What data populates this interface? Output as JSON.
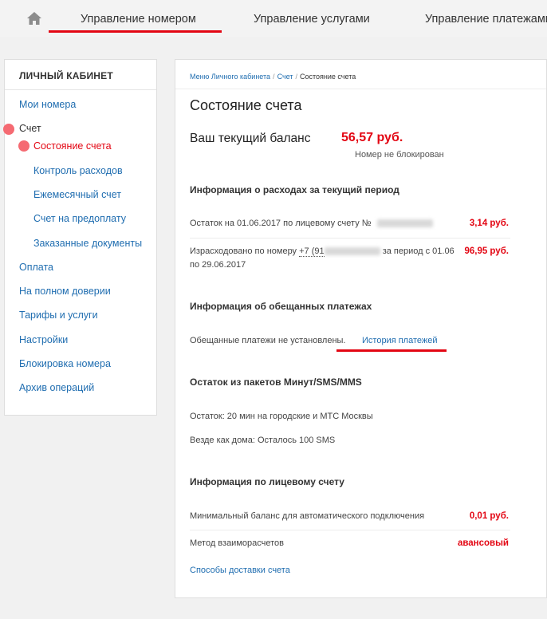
{
  "nav": {
    "tabs": [
      {
        "label": "Управление номером"
      },
      {
        "label": "Управление услугами"
      },
      {
        "label": "Управление платежами"
      }
    ]
  },
  "sidebar": {
    "title": "ЛИЧНЫЙ КАБИНЕТ",
    "items": [
      {
        "label": "Мои номера"
      },
      {
        "label": "Счет"
      },
      {
        "label": "Состояние счета"
      },
      {
        "label": "Контроль расходов"
      },
      {
        "label": "Ежемесячный счет"
      },
      {
        "label": "Счет на предоплату"
      },
      {
        "label": "Заказанные документы"
      },
      {
        "label": "Оплата"
      },
      {
        "label": "На полном доверии"
      },
      {
        "label": "Тарифы и услуги"
      },
      {
        "label": "Настройки"
      },
      {
        "label": "Блокировка номера"
      },
      {
        "label": "Архив операций"
      }
    ]
  },
  "breadcrumb": {
    "items": [
      "Меню Личного кабинета",
      "Счет",
      "Состояние счета"
    ],
    "separator": "/"
  },
  "page": {
    "title": "Состояние счета",
    "balance_label": "Ваш текущий баланс",
    "balance_value": "56,57 руб.",
    "balance_note": "Номер не блокирован"
  },
  "expenses": {
    "heading": "Информация о расходах за текущий период",
    "remainder_text": "Остаток на 01.06.2017 по лицевому счету №",
    "remainder_value": "3,14 руб.",
    "spent_text_a": "Израсходовано по номеру",
    "spent_phone": "+7 (91",
    "spent_text_b": "за период с 01.06",
    "spent_text_c": "по 29.06.2017",
    "spent_value": "96,95 руб."
  },
  "promised": {
    "heading": "Информация об обещанных платежах",
    "status_text": "Обещанные платежи не установлены.",
    "history_link": "История платежей"
  },
  "packages": {
    "heading": "Остаток из пакетов Минут/SMS/MMS",
    "line1": "Остаток: 20 мин на городские и МТС Москвы",
    "line2": "Везде как дома: Осталось 100 SMS"
  },
  "account": {
    "heading": "Информация по лицевому счету",
    "min_balance_text": "Минимальный баланс для автоматического подключения",
    "min_balance_value": "0,01 руб.",
    "method_text": "Метод взаиморасчетов",
    "method_value": "авансовый",
    "delivery_link": "Способы доставки счета"
  },
  "colors": {
    "accent": "#e30613",
    "link": "#1f6db0",
    "marker": "#f56a72"
  }
}
